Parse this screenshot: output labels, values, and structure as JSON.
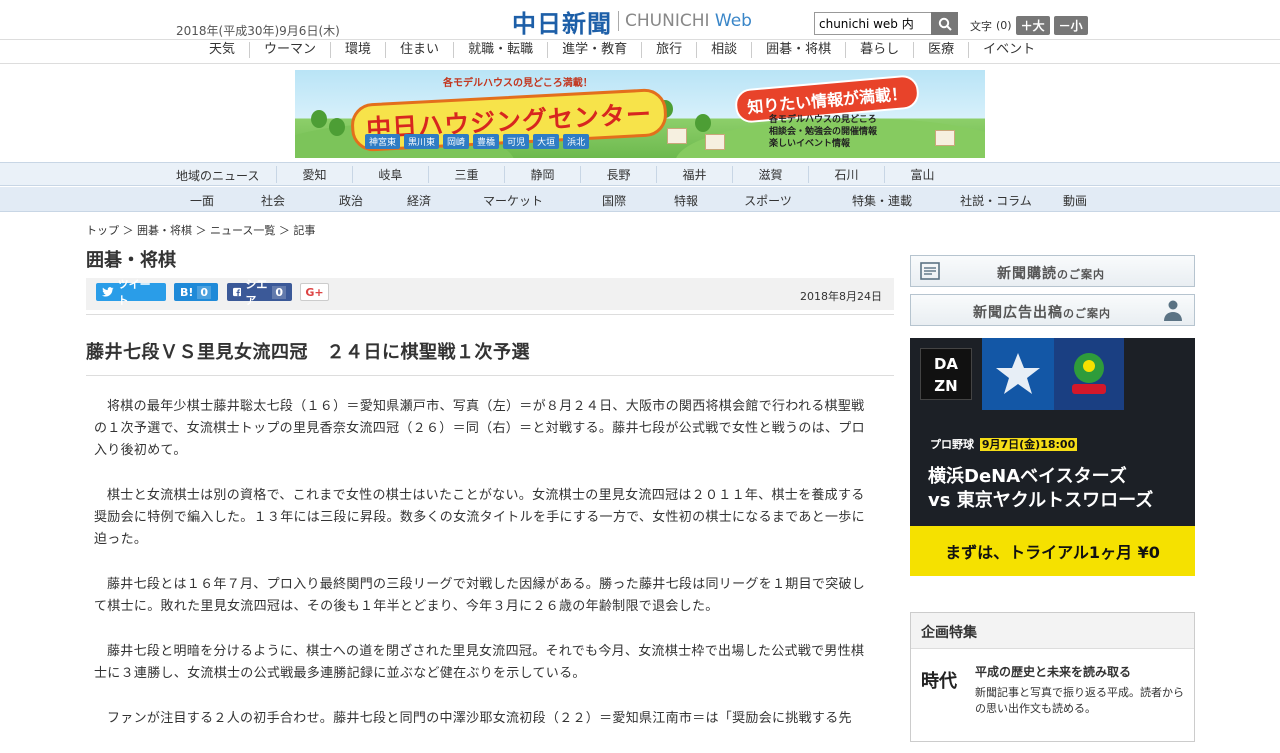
{
  "header": {
    "date": "2018年(平成30年)9月6日(木)",
    "logo_jp": "中日新聞",
    "logo_en_a": "CHUNICHI",
    "logo_en_b": "Web",
    "search_value": "chunichi web 内",
    "fontsize_label": "文字",
    "fontsize_value": "(0)",
    "font_bigger": "＋大",
    "font_smaller": "－小"
  },
  "category_nav": [
    "天気",
    "ウーマン",
    "環境",
    "住まい",
    "就職・転職",
    "進学・教育",
    "旅行",
    "相談",
    "囲碁・将棋",
    "暮らし",
    "医療",
    "イベント"
  ],
  "banner": {
    "sub": "各モデルハウスの見どころ満載！",
    "title": "中日ハウジングセンター",
    "cities": [
      "神宮東",
      "黒川東",
      "岡崎",
      "豊橋",
      "可児",
      "大垣",
      "浜北"
    ],
    "badge": "知りたい情報が満載！",
    "list": [
      "各モデルハウスの見どころ",
      "相談会・勉強会の開催情報",
      "楽しいイベント情報"
    ],
    "colors": {
      "title_red": "#d7261f",
      "title_yellow": "#f7e34a",
      "sky": "#b9e4f6",
      "grass": "#6db94e"
    }
  },
  "region_nav": {
    "label": "地域のニュース",
    "items": [
      "愛知",
      "岐阜",
      "三重",
      "静岡",
      "長野",
      "福井",
      "滋賀",
      "石川",
      "富山"
    ]
  },
  "section_nav": [
    "一面",
    "社会",
    "政治",
    "経済",
    "マーケット",
    "国際",
    "特報",
    "スポーツ",
    "特集・連載",
    "社説・コラム",
    "動画"
  ],
  "breadcrumb": "トップ ＞ 囲碁・将棋 ＞ ニュース一覧 ＞ 記事",
  "section_title": "囲碁・将棋",
  "share": {
    "twitter": "ツイート",
    "hatena": "B!",
    "hatena_count": "0",
    "facebook": "シエア",
    "facebook_count": "0",
    "gplus": "G+"
  },
  "article": {
    "date": "2018年8月24日",
    "headline": "藤井七段ＶＳ里見女流四冠　２４日に棋聖戦１次予選",
    "paragraphs": [
      "将棋の最年少棋士藤井聡太七段（１６）＝愛知県瀬戸市、写真（左）＝が８月２４日、大阪市の関西将棋会館で行われる棋聖戦の１次予選で、女流棋士トップの里見香奈女流四冠（２６）＝同（右）＝と対戦する。藤井七段が公式戦で女性と戦うのは、プロ入り後初めて。",
      "棋士と女流棋士は別の資格で、これまで女性の棋士はいたことがない。女流棋士の里見女流四冠は２０１１年、棋士を養成する奨励会に特例で編入した。１３年には三段に昇段。数多くの女流タイトルを手にする一方で、女性初の棋士になるまであと一歩に迫った。",
      "藤井七段とは１６年７月、プロ入り最終関門の三段リーグで対戦した因縁がある。勝った藤井七段は同リーグを１期目で突破して棋士に。敗れた里見女流四冠は、その後も１年半とどまり、今年３月に２６歳の年齢制限で退会した。",
      "藤井七段と明暗を分けるように、棋士への道を閉ざされた里見女流四冠。それでも今月、女流棋士枠で出場した公式戦で男性棋士に３連勝し、女流棋士の公式戦最多連勝記録に並ぶなど健在ぶりを示している。",
      "ファンが注目する２人の初手合わせ。藤井七段と同門の中澤沙耶女流初段（２２）＝愛知県江南市＝は「奨励会に挑戦する先"
    ]
  },
  "sidebar": {
    "subscribe": {
      "main": "新聞購読",
      "tail": "のご案内"
    },
    "ad": {
      "main": "新聞広告出稿",
      "tail": "のご案内"
    },
    "dazn": {
      "logo": [
        "DA",
        "ZN"
      ],
      "category": "プロ野球",
      "when": "9月7日(金)18:00",
      "team1": "横浜DeNAベイスターズ",
      "team2": "vs 東京ヤクルトスワローズ",
      "cta": "まずは、トライアル1ヶ月 ¥0",
      "colors": {
        "bg": "#1c2026",
        "cta": "#f5e100"
      }
    },
    "feature": {
      "heading": "企画特集",
      "logo": "時代",
      "title": "平成の歴史と未来を読み取る",
      "desc": "新聞記事と写真で振り返る平成。読者からの思い出作文も読める。"
    }
  },
  "icons": [
    "search-icon",
    "twitter-bird-icon",
    "facebook-f-icon",
    "newspaper-icon",
    "person-icon"
  ]
}
